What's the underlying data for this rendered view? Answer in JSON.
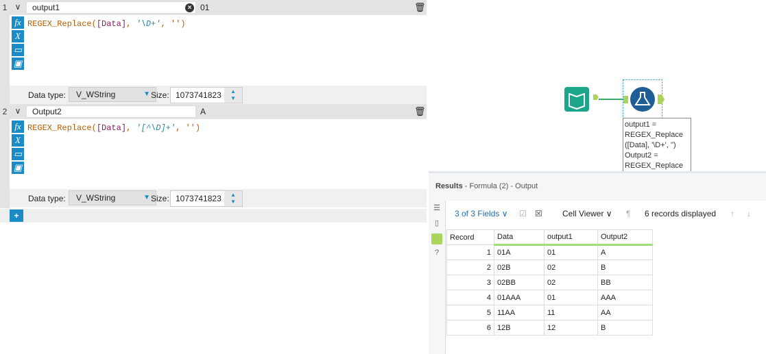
{
  "expressions": [
    {
      "index": "1",
      "name": "output1",
      "preview": "01",
      "code": {
        "func": "REGEX_Replace(",
        "field": "[Data]",
        "sep": ", ",
        "pattern": "'\\D+'",
        "rest": ", '')"
      },
      "data_type_label": "Data type:",
      "data_type": "V_WString",
      "size_label": "Size:",
      "size": "1073741823"
    },
    {
      "index": "2",
      "name": "Output2",
      "preview": "A",
      "code": {
        "func": "REGEX_Replace(",
        "field": "[Data]",
        "sep": ", ",
        "pattern": "'[^\\D]+'",
        "rest": ", '')"
      },
      "data_type_label": "Data type:",
      "data_type": "V_WString",
      "size_label": "Size:",
      "size": "1073741823"
    }
  ],
  "canvas": {
    "annotation": [
      "output1 =",
      "REGEX_Replace",
      "([Data], '\\D+', '')",
      "Output2 =",
      "REGEX_Replace"
    ]
  },
  "results": {
    "title": "Results",
    "subtitle": " - Formula (2) - Output",
    "fields": "3 of 3 Fields",
    "viewer": "Cell Viewer",
    "count": "6 records displayed",
    "columns": [
      "Record",
      "Data",
      "output1",
      "Output2"
    ],
    "rows": [
      [
        "1",
        "01A",
        "01",
        "A"
      ],
      [
        "2",
        "02B",
        "02",
        "B"
      ],
      [
        "3",
        "02BB",
        "02",
        "BB"
      ],
      [
        "4",
        "01AAA",
        "01",
        "AAA"
      ],
      [
        "5",
        "11AA",
        "11",
        "AA"
      ],
      [
        "6",
        "12B",
        "12",
        "B"
      ]
    ]
  }
}
